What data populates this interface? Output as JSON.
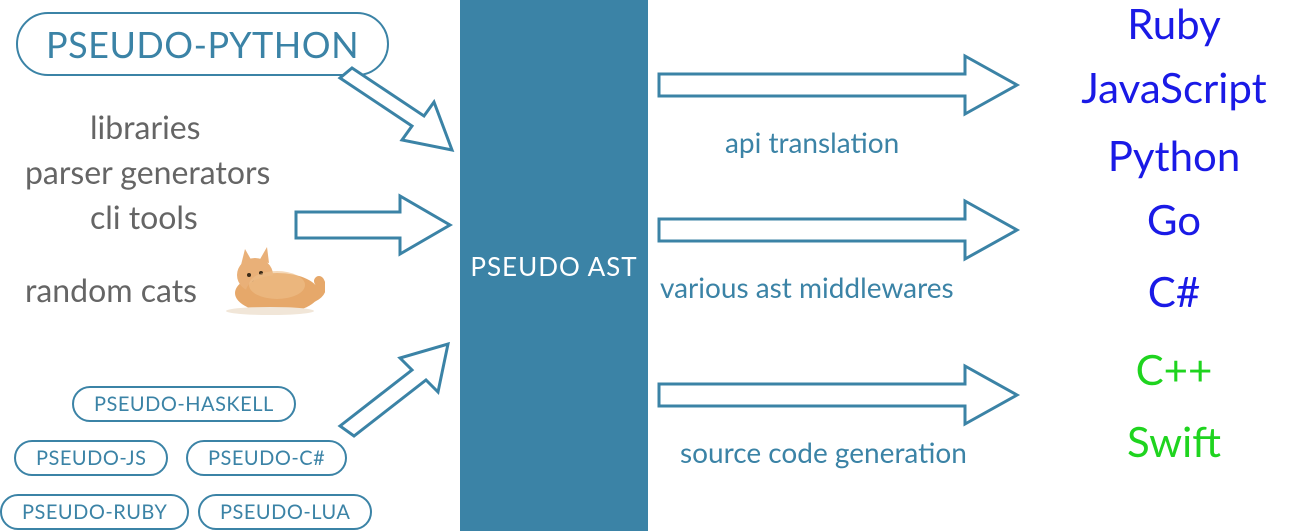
{
  "inputs": {
    "main_pill": "PSEUDO-PYTHON",
    "lines": [
      "libraries",
      "parser generators",
      "cli tools",
      "random cats"
    ],
    "small_pills": [
      "PSEUDO-HASKELL",
      "PSEUDO-JS",
      "PSEUDO-C#",
      "PSEUDO-RUBY",
      "PSEUDO-LUA"
    ]
  },
  "center": {
    "label": "PSEUDO AST"
  },
  "arrows_right": {
    "captions": [
      "api translation",
      "various  ast middlewares",
      "source code generation"
    ]
  },
  "outputs": {
    "blue": [
      "Ruby",
      "JavaScript",
      "Python",
      "Go",
      "C#"
    ],
    "green": [
      "C++",
      "Swift"
    ]
  },
  "colors": {
    "teal": "#3b83a6",
    "grey": "#656565",
    "blue": "#1a1ae6",
    "green": "#1fd41f"
  }
}
